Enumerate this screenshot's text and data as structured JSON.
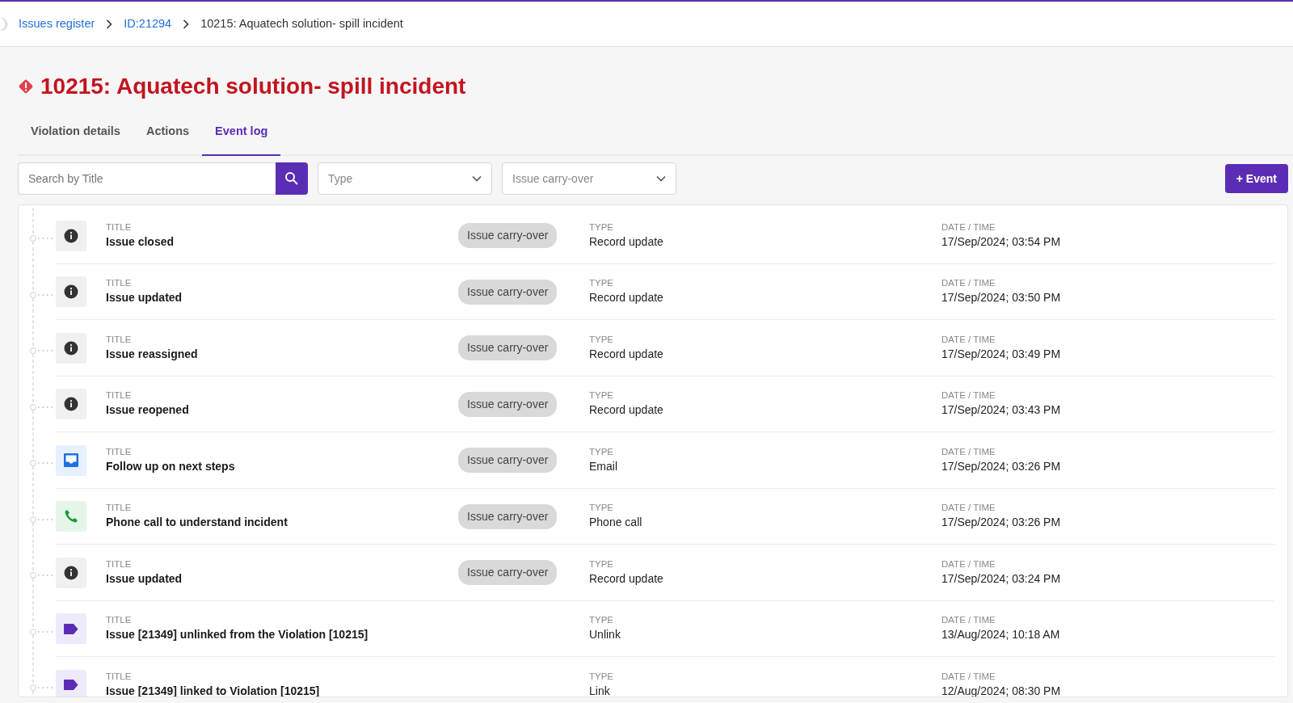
{
  "breadcrumb": [
    {
      "label": "Issues register",
      "link": true
    },
    {
      "label": "ID:21294",
      "link": true
    },
    {
      "label": "10215: Aquatech solution- spill incident",
      "link": false
    }
  ],
  "page_title": "10215: Aquatech solution- spill incident",
  "tabs": [
    {
      "label": "Violation details",
      "selected": false
    },
    {
      "label": "Actions",
      "selected": false
    },
    {
      "label": "Event log",
      "selected": true
    }
  ],
  "filters": {
    "search": {
      "placeholder": "Search by Title"
    },
    "dropdowns": [
      {
        "placeholder": "Type"
      },
      {
        "placeholder": "Issue carry-over"
      }
    ],
    "add_button": {
      "icon": "+",
      "label": "Event"
    }
  },
  "events": [
    {
      "kind": "info",
      "title_label": "TITLE",
      "title": "Issue closed",
      "tag": "Issue carry-over",
      "type_label": "TYPE",
      "type": "Record update",
      "date_label": "DATE / TIME",
      "date": "17/Sep/2024; 03:54 PM"
    },
    {
      "kind": "info",
      "title_label": "TITLE",
      "title": "Issue updated",
      "tag": "Issue carry-over",
      "type_label": "TYPE",
      "type": "Record update",
      "date_label": "DATE / TIME",
      "date": "17/Sep/2024; 03:50 PM"
    },
    {
      "kind": "info",
      "title_label": "TITLE",
      "title": "Issue reassigned",
      "tag": "Issue carry-over",
      "type_label": "TYPE",
      "type": "Record update",
      "date_label": "DATE / TIME",
      "date": "17/Sep/2024; 03:49 PM"
    },
    {
      "kind": "info",
      "title_label": "TITLE",
      "title": "Issue reopened",
      "tag": "Issue carry-over",
      "type_label": "TYPE",
      "type": "Record update",
      "date_label": "DATE / TIME",
      "date": "17/Sep/2024; 03:43 PM"
    },
    {
      "kind": "email",
      "title_label": "TITLE",
      "title": "Follow up on next steps",
      "tag": "Issue carry-over",
      "type_label": "TYPE",
      "type": "Email",
      "date_label": "DATE / TIME",
      "date": "17/Sep/2024; 03:26 PM"
    },
    {
      "kind": "phone",
      "title_label": "TITLE",
      "title": "Phone call to understand incident",
      "tag": "Issue carry-over",
      "type_label": "TYPE",
      "type": "Phone call",
      "date_label": "DATE / TIME",
      "date": "17/Sep/2024; 03:26 PM"
    },
    {
      "kind": "info",
      "title_label": "TITLE",
      "title": "Issue updated",
      "tag": "Issue carry-over",
      "type_label": "TYPE",
      "type": "Record update",
      "date_label": "DATE / TIME",
      "date": "17/Sep/2024; 03:24 PM"
    },
    {
      "kind": "link",
      "title_label": "TITLE",
      "title": "Issue [21349] unlinked from the Violation [10215]",
      "type_label": "TYPE",
      "type": "Unlink",
      "date_label": "DATE / TIME",
      "date": "13/Aug/2024; 10:18 AM"
    },
    {
      "kind": "link",
      "title_label": "TITLE",
      "title": "Issue [21349] linked to Violation [10215]",
      "type_label": "TYPE",
      "type": "Link",
      "date_label": "DATE / TIME",
      "date": "12/Aug/2024; 08:30 PM"
    }
  ]
}
